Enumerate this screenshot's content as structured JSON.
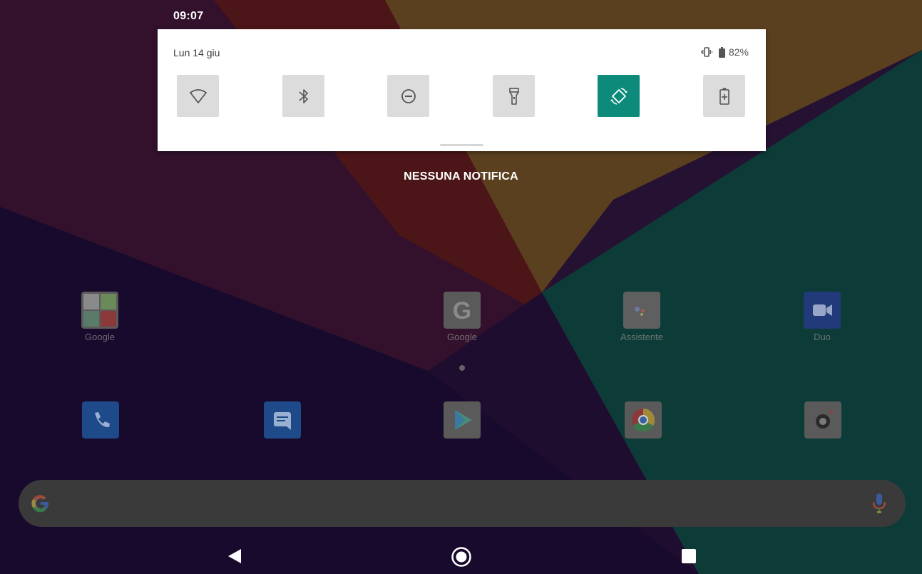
{
  "status_bar": {
    "time": "09:07"
  },
  "quick_settings": {
    "date": "Lun 14 giu",
    "battery_percent": "82%",
    "tiles": [
      {
        "id": "wifi",
        "icon": "wifi-icon",
        "active": false
      },
      {
        "id": "bluetooth",
        "icon": "bluetooth-icon",
        "active": false
      },
      {
        "id": "dnd",
        "icon": "do-not-disturb-icon",
        "active": false
      },
      {
        "id": "flashlight",
        "icon": "flashlight-icon",
        "active": false
      },
      {
        "id": "auto-rotate",
        "icon": "auto-rotate-icon",
        "active": true
      },
      {
        "id": "battery-saver",
        "icon": "battery-saver-icon",
        "active": false
      }
    ],
    "accent_color": "#0d8a7a"
  },
  "notifications": {
    "empty_label": "NESSUNA NOTIFICA"
  },
  "home": {
    "apps": [
      {
        "label": "Google",
        "icon": "google-folder-icon"
      },
      {
        "label": "Google",
        "icon": "google-g-icon"
      },
      {
        "label": "Assistente",
        "icon": "assistant-icon"
      },
      {
        "label": "Duo",
        "icon": "duo-icon"
      }
    ],
    "dock": [
      {
        "icon": "phone-icon"
      },
      {
        "icon": "messages-icon"
      },
      {
        "icon": "play-store-icon"
      },
      {
        "icon": "chrome-icon"
      },
      {
        "icon": "camera-icon"
      }
    ]
  },
  "search_bar": {
    "left_icon": "google-g-icon",
    "right_icon": "mic-icon"
  },
  "navigation": {
    "buttons": [
      "back-icon",
      "home-icon",
      "recents-icon"
    ]
  }
}
